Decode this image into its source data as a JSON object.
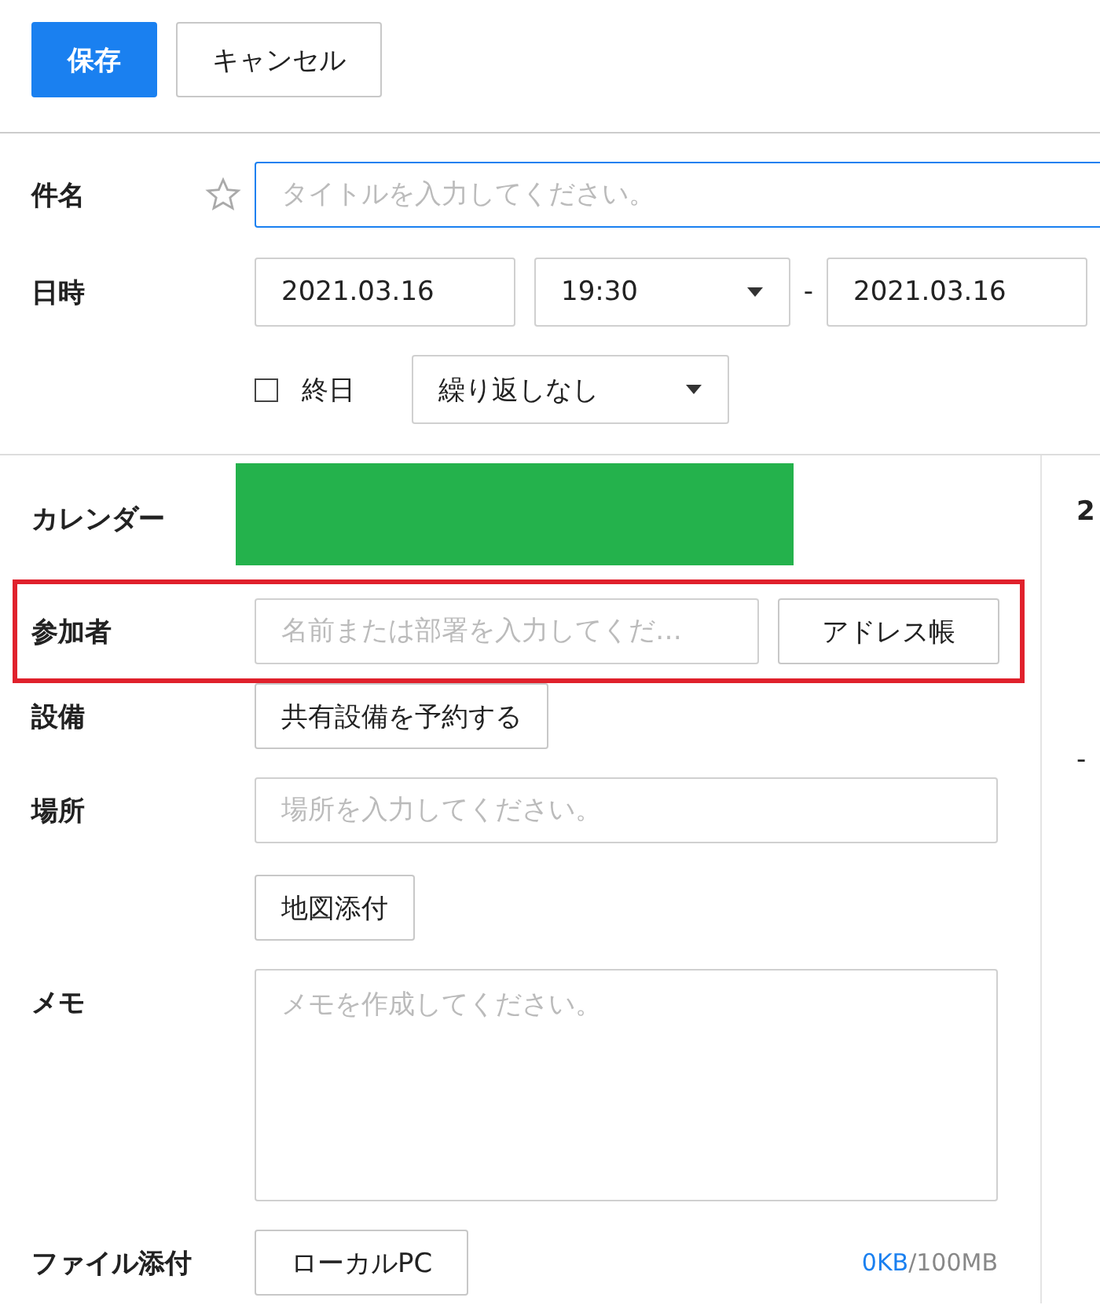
{
  "toolbar": {
    "buttons": [
      {
        "label": "保存",
        "kind": "primary"
      },
      {
        "label": "キャンセル",
        "kind": "default"
      }
    ]
  },
  "subject": {
    "label": "件名",
    "starred": false,
    "placeholder": "タイトルを入力してください。"
  },
  "datetime": {
    "label": "日時",
    "start_date": "2021.03.16",
    "start_time": "19:30",
    "separator": "-",
    "end_date": "2021.03.16",
    "all_day": {
      "label": "終日",
      "checked": false
    },
    "repeat": "繰り返しなし"
  },
  "calendar": {
    "label": "カレンダー",
    "color": "#24b24c"
  },
  "attendees": {
    "label": "参加者",
    "placeholder": "名前または部署を入力してくだ…",
    "button": "アドレス帳",
    "highlighted": true
  },
  "equipment": {
    "label": "設備",
    "button": "共有設備を予約する"
  },
  "place": {
    "label": "場所",
    "placeholder": "場所を入力してください。",
    "button": "地図添付"
  },
  "memo": {
    "label": "メモ",
    "placeholder": "メモを作成してください。"
  },
  "attachment": {
    "label": "ファイル添付",
    "button": "ローカルPC",
    "used": "0KB",
    "limit": "/100MB"
  },
  "side_panel": {
    "texts": [
      "2",
      "-"
    ]
  }
}
